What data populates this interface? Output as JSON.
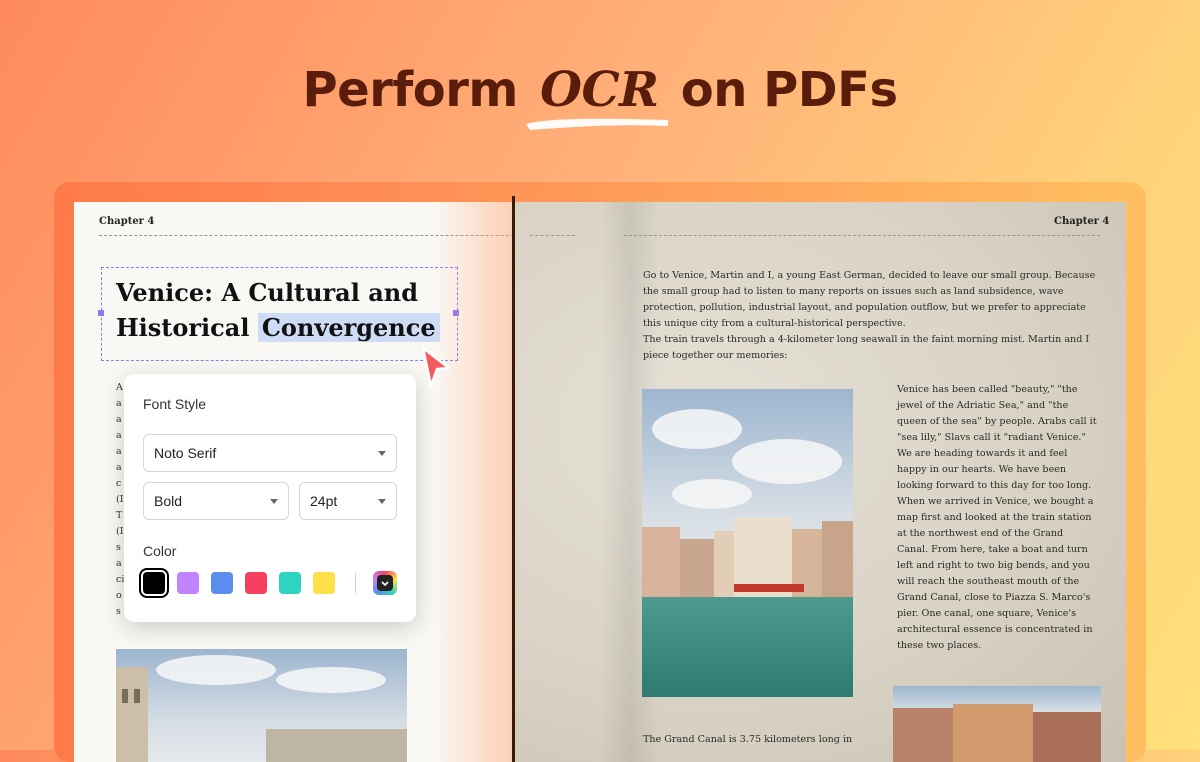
{
  "headline": {
    "prefix": "Perform",
    "highlight": "OCR",
    "suffix": "on PDFs"
  },
  "left_page": {
    "chapter": "Chapter 4",
    "title_line1": "Venice: A Cultural and",
    "title_line2_plain": "Historical",
    "title_line2_selected": "Convergence",
    "body_lines": [
      "A                                           ves like Venus. Transparent",
      "a                                            The convergence of Eastern",
      "a                                           e your wisdom in joy. These",
      "a                                          may be small in size and short",
      "a                                           In the Middle Ages,",
      "a                                          , forging its own unique",
      "c                                          erged, such as Titian, Vecelli",
      "(I                                         3), and Giovanni Battista",
      "T                                          works as Michele Sanmicheli",
      "(I                                         ulptor and architect Jacoop",
      "s                                           rous offer for him to return,",
      "a                                          an absolute monarchy. He",
      "                                              cided to go to Venice, we left",
      "o                                           reports about land",
      "s                                          ulation outflow, and we"
    ]
  },
  "font_popup": {
    "font_style_label": "Font Style",
    "font_family": "Noto Serif",
    "weight": "Bold",
    "size": "24pt",
    "color_label": "Color",
    "swatches": [
      "#000000",
      "#c084fc",
      "#5b8def",
      "#f43f5e",
      "#2dd4bf",
      "#fde047"
    ],
    "selected_swatch": "#000000"
  },
  "right_page": {
    "chapter": "Chapter 4",
    "intro_lines": [
      "Go to Venice, Martin and I, a young East German, decided to leave our small group. Because",
      "the small group had to listen to many reports on issues such as land subsidence, wave",
      "protection, pollution, industrial layout, and population outflow, but we prefer to appreciate",
      "this unique city from a cultural-historical perspective.",
      "The train travels through a 4-kilometer long seawall in the faint morning mist. Martin and I",
      "piece together our memories:"
    ],
    "column_lines": [
      "Venice has been called \"beauty,\" \"the",
      "jewel of the Adriatic Sea,\" and \"the",
      "queen of the sea\" by people. Arabs call it",
      "\"sea lily,\" Slavs call it \"radiant Venice.\"",
      "We are heading towards it and feel",
      "happy in our hearts. We have been",
      "looking forward to this day for too long.",
      "When we arrived in Venice, we bought a",
      "map first and looked at the train station",
      "at the northwest end of the Grand",
      "Canal. From here, take a boat and turn",
      "left and right to two big bends, and you",
      "will reach the southeast mouth of the",
      "Grand Canal, close to Piazza S. Marco's",
      "pier. One canal, one square, Venice's",
      "architectural essence is concentrated in",
      "these two places."
    ],
    "bottom_line": "The Grand Canal is 3.75 kilometers long in"
  }
}
